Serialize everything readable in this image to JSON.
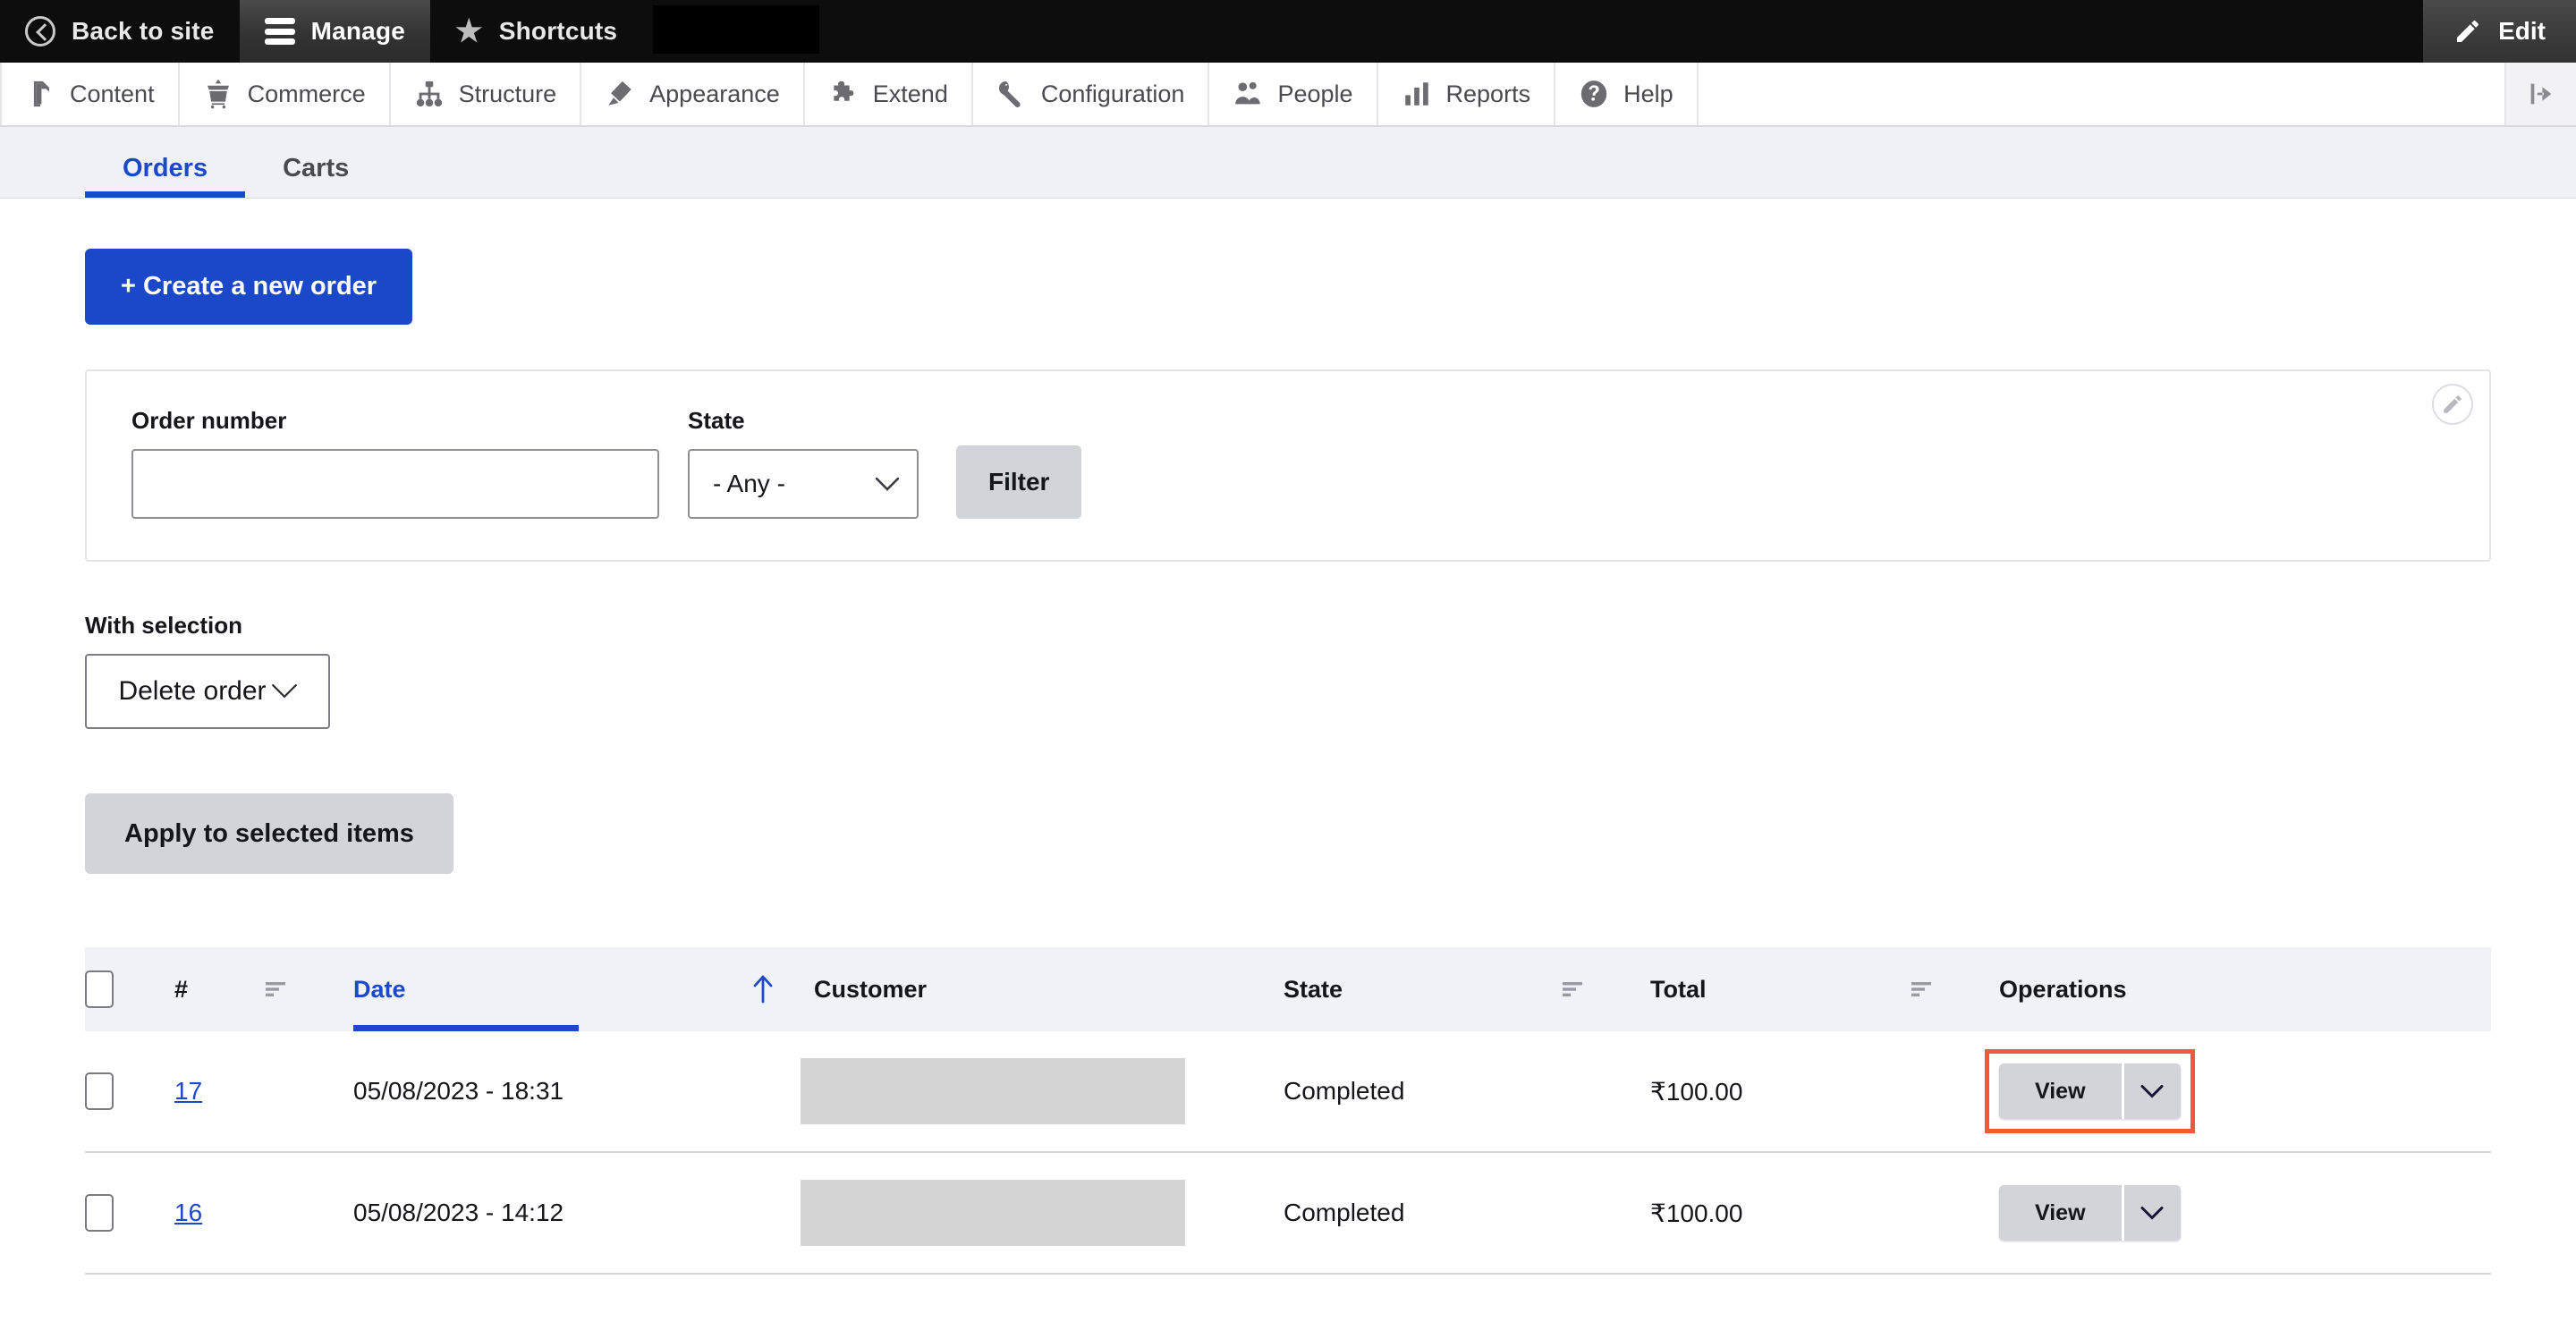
{
  "toolbar": {
    "back_to_site": "Back to site",
    "manage": "Manage",
    "shortcuts": "Shortcuts",
    "edit": "Edit"
  },
  "admin_menu": {
    "items": [
      {
        "label": "Content",
        "icon": "file-icon"
      },
      {
        "label": "Commerce",
        "icon": "shopping-cart-icon"
      },
      {
        "label": "Structure",
        "icon": "sitemap-icon"
      },
      {
        "label": "Appearance",
        "icon": "paintbrush-icon"
      },
      {
        "label": "Extend",
        "icon": "puzzle-piece-icon"
      },
      {
        "label": "Configuration",
        "icon": "wrench-icon"
      },
      {
        "label": "People",
        "icon": "people-icon"
      },
      {
        "label": "Reports",
        "icon": "bar-chart-icon"
      },
      {
        "label": "Help",
        "icon": "question-circle-icon"
      }
    ],
    "toggle_icon": "collapse-sidebar-icon"
  },
  "tabs": [
    {
      "label": "Orders",
      "active": true
    },
    {
      "label": "Carts",
      "active": false
    }
  ],
  "actions": {
    "create_order": "+ Create a new order"
  },
  "filters": {
    "order_number_label": "Order number",
    "order_number_value": "",
    "order_number_placeholder": "",
    "state_label": "State",
    "state_value": "- Any -",
    "filter_button": "Filter",
    "contextual_edit_icon": "pencil-icon"
  },
  "bulk": {
    "with_selection_label": "With selection",
    "action_value": "Delete order",
    "apply_button": "Apply to selected items"
  },
  "table": {
    "columns": [
      {
        "key": "select",
        "label": ""
      },
      {
        "key": "number",
        "label": "#",
        "sortable": true
      },
      {
        "key": "date",
        "label": "Date",
        "sorted": true,
        "sort_direction": "asc"
      },
      {
        "key": "customer",
        "label": "Customer"
      },
      {
        "key": "state",
        "label": "State",
        "sortable": true
      },
      {
        "key": "total",
        "label": "Total",
        "sortable": true
      },
      {
        "key": "operations",
        "label": "Operations"
      }
    ],
    "rows": [
      {
        "number": "17",
        "date": "05/08/2023 - 18:31",
        "customer": "",
        "state": "Completed",
        "total": "₹100.00",
        "operation_label": "View",
        "highlighted": true
      },
      {
        "number": "16",
        "date": "05/08/2023 - 14:12",
        "customer": "",
        "state": "Completed",
        "total": "₹100.00",
        "operation_label": "View",
        "highlighted": false
      }
    ]
  },
  "colors": {
    "accent_blue": "#1b48c8",
    "toolbar_dark": "#0d0d0d",
    "highlight_orange": "#f05a34",
    "button_grey": "#d3d4d9",
    "tabs_bg": "#f0f1f7"
  }
}
